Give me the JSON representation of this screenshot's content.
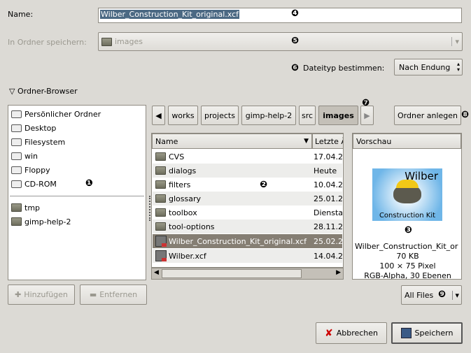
{
  "name_label": "Name:",
  "name_value": "Wilber_Construction_Kit_original.xcf",
  "folder_label": "In Ordner speichern:",
  "folder_value": "images",
  "filetype_label": "Dateityp bestimmen:",
  "filetype_value": "Nach Endung",
  "browser_toggle": "Ordner-Browser",
  "places": [
    "Persönlicher Ordner",
    "Desktop",
    "Filesystem",
    "win",
    "Floppy",
    "CD-ROM"
  ],
  "bookmarks": [
    "tmp",
    "gimp-help-2"
  ],
  "path": [
    "works",
    "projects",
    "gimp-help-2",
    "src",
    "images"
  ],
  "create_folder": "Ordner anlegen",
  "columns": {
    "name": "Name",
    "date": "Letzte Ä"
  },
  "files": [
    {
      "name": "CVS",
      "date": "17.04.2",
      "type": "folder"
    },
    {
      "name": "dialogs",
      "date": "Heute",
      "type": "folder"
    },
    {
      "name": "filters",
      "date": "10.04.2",
      "type": "folder"
    },
    {
      "name": "glossary",
      "date": "25.01.2",
      "type": "folder"
    },
    {
      "name": "toolbox",
      "date": "Diensta",
      "type": "folder"
    },
    {
      "name": "tool-options",
      "date": "28.11.2",
      "type": "folder"
    },
    {
      "name": "Wilber_Construction_Kit_original.xcf",
      "date": "25.02.2",
      "type": "xcf",
      "selected": true
    },
    {
      "name": "Wilber.xcf",
      "date": "14.04.2",
      "type": "xcf"
    }
  ],
  "preview": {
    "header": "Vorschau",
    "img_title": "Wilber",
    "img_caption": "Construction Kit",
    "filename": "Wilber_Construction_Kit_or",
    "size": "70 KB",
    "dims": "100 × 75 Pixel",
    "info": "RGB-Alpha, 30 Ebenen"
  },
  "add": "Hinzufügen",
  "remove": "Entfernen",
  "filter": "All Files",
  "cancel": "Abbrechen",
  "save": "Speichern",
  "markers": [
    "❶",
    "❷",
    "❸",
    "❹",
    "❺",
    "❻",
    "❼",
    "❽",
    "❾"
  ],
  "colors": {
    "selection": "#857e73",
    "text_selection": "#4b6983"
  }
}
